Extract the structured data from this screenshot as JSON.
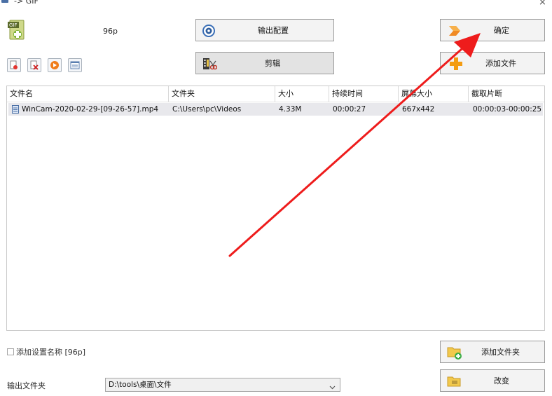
{
  "window": {
    "title": "-> GIF",
    "close_glyph": "×"
  },
  "profile": {
    "name": "96p"
  },
  "buttons": {
    "output_config": "输出配置",
    "edit": "剪辑",
    "confirm": "确定",
    "add_file": "添加文件",
    "add_folder": "添加文件夹",
    "change": "改变"
  },
  "table": {
    "columns": [
      "文件名",
      "文件夹",
      "大小",
      "持续时间",
      "屏幕大小",
      "截取片断"
    ],
    "rows": [
      {
        "name": "WinCam-2020-02-29-[09-26-57].mp4",
        "folder": "C:\\Users\\pc\\Videos",
        "size": "4.33M",
        "duration": "00:00:27",
        "screen": "667x442",
        "clip": "00:00:03-00:00:25"
      }
    ]
  },
  "options": {
    "add_setting_name_label": "添加设置名称 [96p]"
  },
  "output": {
    "folder_label": "输出文件夹",
    "folder_value": "D:\\tools\\桌面\\文件"
  },
  "colors": {
    "annotation_arrow": "#ee1c1c",
    "row_highlight": "#e8e8ec",
    "button_bg": "#f3f3f3"
  }
}
